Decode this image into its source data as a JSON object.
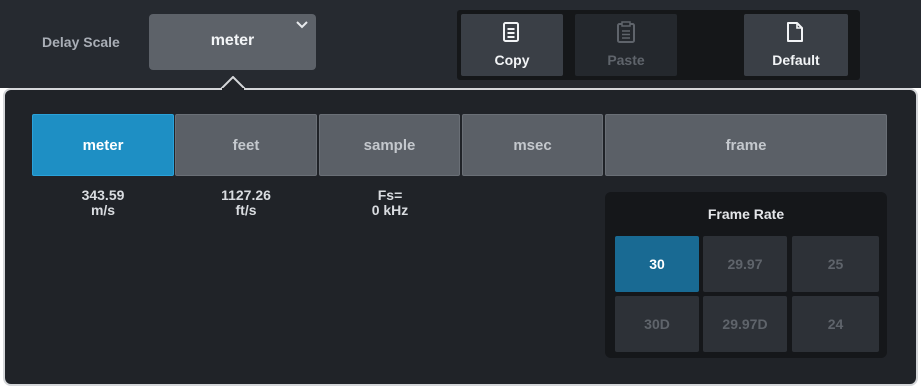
{
  "header": {
    "delay_scale_label": "Delay Scale",
    "delay_scale_value": "meter",
    "copy_label": "Copy",
    "paste_label": "Paste",
    "default_label": "Default"
  },
  "scale_tabs": [
    {
      "label": "meter",
      "active": true
    },
    {
      "label": "feet",
      "active": false
    },
    {
      "label": "sample",
      "active": false
    },
    {
      "label": "msec",
      "active": false
    },
    {
      "label": "frame",
      "active": false
    }
  ],
  "scale_info": {
    "meter": {
      "line1": "343.59",
      "line2": "m/s"
    },
    "feet": {
      "line1": "1127.26",
      "line2": "ft/s"
    },
    "sample": {
      "line1": "Fs=",
      "line2": "0 kHz"
    }
  },
  "frame_rate": {
    "title": "Frame Rate",
    "options": [
      {
        "label": "30",
        "active": true
      },
      {
        "label": "29.97",
        "active": false
      },
      {
        "label": "25",
        "active": false
      },
      {
        "label": "30D",
        "active": false
      },
      {
        "label": "29.97D",
        "active": false
      },
      {
        "label": "24",
        "active": false
      }
    ]
  },
  "colors": {
    "accent": "#1e8fc4",
    "frame_rate_selected": "#196a93",
    "background": "#202328"
  },
  "icons": {
    "dropdown": "chevron-down-icon",
    "copy": "copy-icon",
    "paste": "paste-icon",
    "default": "document-icon"
  }
}
